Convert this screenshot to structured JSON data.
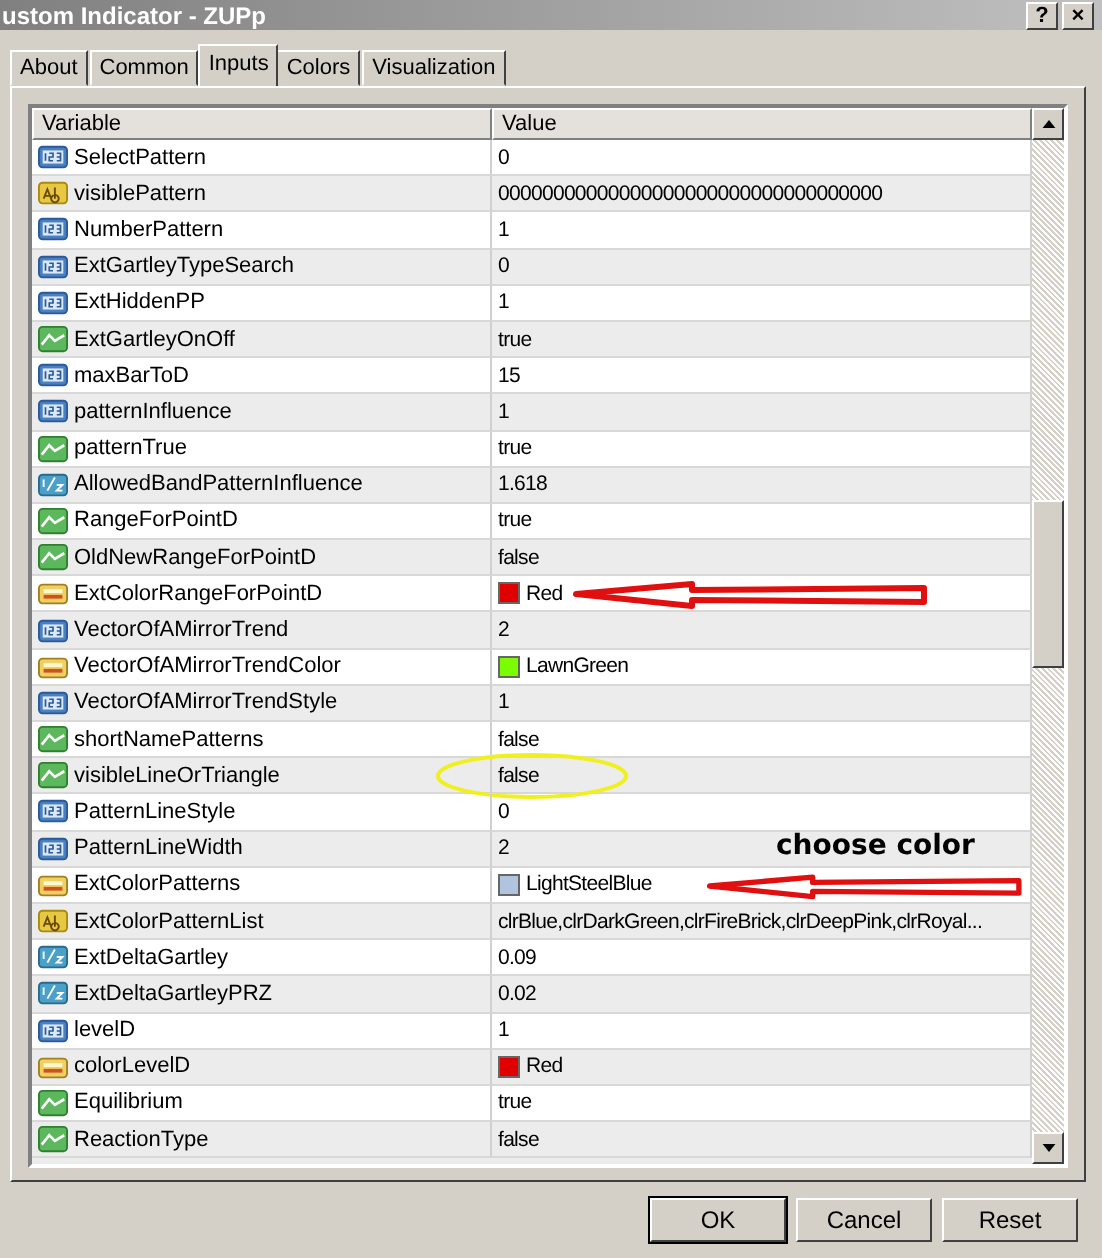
{
  "window": {
    "title": "ustom Indicator - ZUPp",
    "help": "?",
    "close": "×"
  },
  "tabs": [
    {
      "label": "About",
      "selected": false
    },
    {
      "label": "Common",
      "selected": false
    },
    {
      "label": "Inputs",
      "selected": true
    },
    {
      "label": "Colors",
      "selected": false
    },
    {
      "label": "Visualization",
      "selected": false
    }
  ],
  "table": {
    "columns": [
      "Variable",
      "Value"
    ],
    "rows": [
      {
        "kind": "int",
        "name": "SelectPattern",
        "value": "0"
      },
      {
        "kind": "string",
        "name": "visiblePattern",
        "value": "00000000000000000000000000000000000"
      },
      {
        "kind": "int",
        "name": "NumberPattern",
        "value": "1"
      },
      {
        "kind": "int",
        "name": "ExtGartleyTypeSearch",
        "value": "0"
      },
      {
        "kind": "int",
        "name": "ExtHiddenPP",
        "value": "1"
      },
      {
        "kind": "bool",
        "name": "ExtGartleyOnOff",
        "value": "true"
      },
      {
        "kind": "int",
        "name": "maxBarToD",
        "value": "15"
      },
      {
        "kind": "int",
        "name": "patternInfluence",
        "value": "1"
      },
      {
        "kind": "bool",
        "name": "patternTrue",
        "value": "true"
      },
      {
        "kind": "double",
        "name": "AllowedBandPatternInfluence",
        "value": "1.618"
      },
      {
        "kind": "bool",
        "name": "RangeForPointD",
        "value": "true"
      },
      {
        "kind": "bool",
        "name": "OldNewRangeForPointD",
        "value": "false"
      },
      {
        "kind": "color",
        "name": "ExtColorRangeForPointD",
        "value": "Red",
        "color": "#e00000",
        "annotation": {
          "kind": "arrow"
        }
      },
      {
        "kind": "int",
        "name": "VectorOfAMirrorTrend",
        "value": "2"
      },
      {
        "kind": "color",
        "name": "VectorOfAMirrorTrendColor",
        "value": "LawnGreen",
        "color": "#7cfc00"
      },
      {
        "kind": "int",
        "name": "VectorOfAMirrorTrendStyle",
        "value": "1"
      },
      {
        "kind": "bool",
        "name": "shortNamePatterns",
        "value": "false"
      },
      {
        "kind": "bool",
        "name": "visibleLineOrTriangle",
        "value": "false",
        "annotation": {
          "kind": "circle"
        }
      },
      {
        "kind": "int",
        "name": "PatternLineStyle",
        "value": "0"
      },
      {
        "kind": "int",
        "name": "PatternLineWidth",
        "value": "2"
      },
      {
        "kind": "color",
        "name": "ExtColorPatterns",
        "value": "LightSteelBlue",
        "color": "#b0c4de",
        "annotation": {
          "kind": "arrow",
          "note": "choose color"
        }
      },
      {
        "kind": "string",
        "name": "ExtColorPatternList",
        "value": "clrBlue,clrDarkGreen,clrFireBrick,clrDeepPink,clrRoyal..."
      },
      {
        "kind": "double",
        "name": "ExtDeltaGartley",
        "value": "0.09"
      },
      {
        "kind": "double",
        "name": "ExtDeltaGartleyPRZ",
        "value": "0.02"
      },
      {
        "kind": "int",
        "name": "levelD",
        "value": "1"
      },
      {
        "kind": "color",
        "name": "colorLevelD",
        "value": "Red",
        "color": "#e00000"
      },
      {
        "kind": "bool",
        "name": "Equilibrium",
        "value": "true"
      },
      {
        "kind": "bool",
        "name": "ReactionType",
        "value": "false"
      }
    ]
  },
  "buttons": [
    "OK",
    "Cancel",
    "Reset"
  ]
}
